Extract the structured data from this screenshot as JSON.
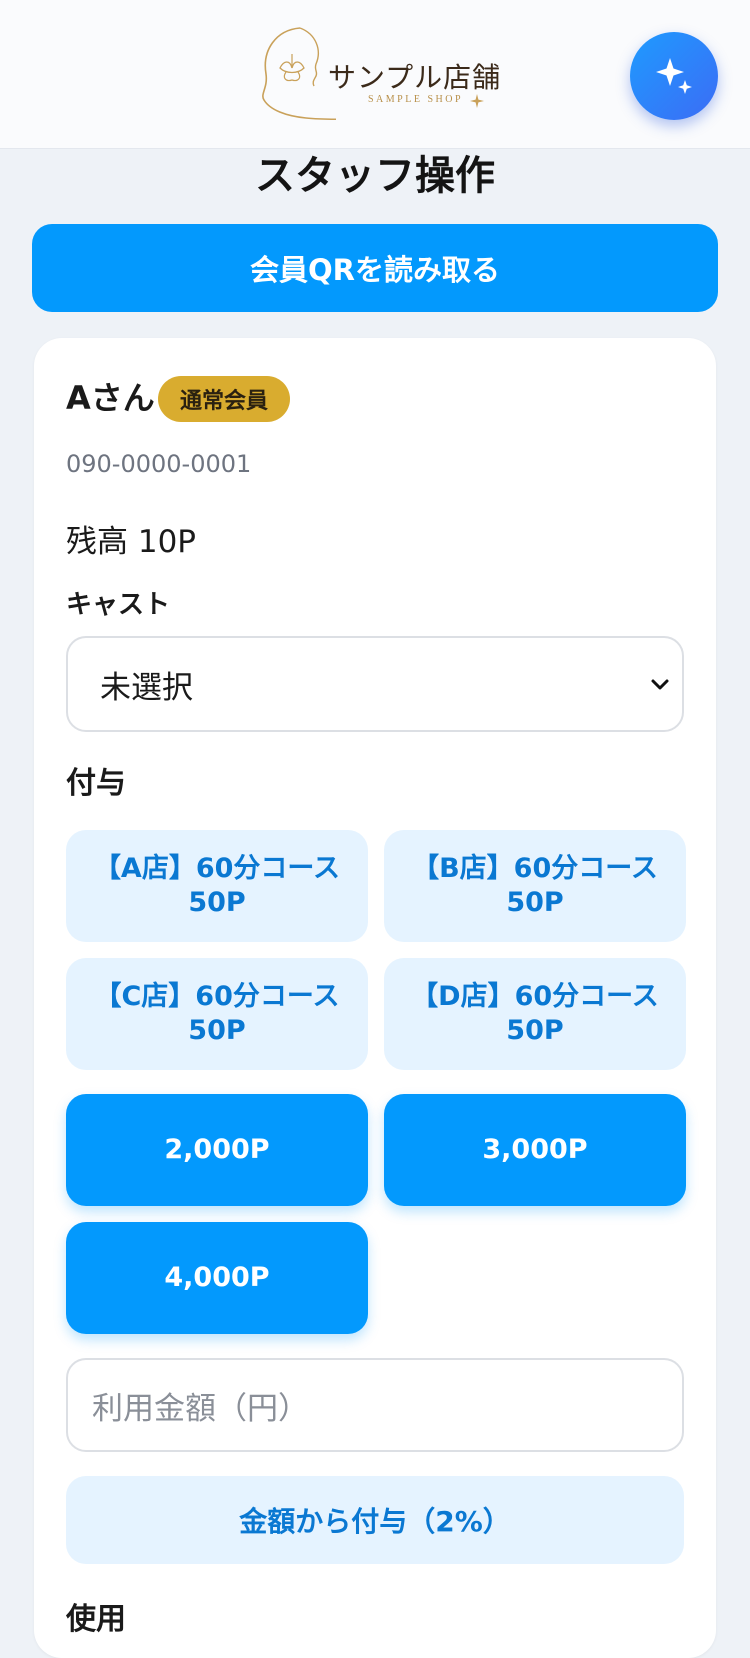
{
  "header": {
    "logo_text": "サンプル店舗",
    "logo_sub": "SAMPLE SHOP",
    "ai_icon": "sparkles-icon"
  },
  "page": {
    "title": "スタッフ操作",
    "scan_button": "会員QRを読み取る"
  },
  "member": {
    "name": "Aさん",
    "badge": "通常会員",
    "phone": "090-0000-0001",
    "balance": "残高 10P"
  },
  "cast": {
    "label": "キャスト",
    "selected": "未選択"
  },
  "grant": {
    "label": "付与",
    "courses": [
      {
        "line1": "【A店】60分コース",
        "line2": "50P"
      },
      {
        "line1": "【B店】60分コース",
        "line2": "50P"
      },
      {
        "line1": "【C店】60分コース",
        "line2": "50P"
      },
      {
        "line1": "【D店】60分コース",
        "line2": "50P"
      }
    ],
    "points": [
      "2,000P",
      "3,000P",
      "4,000P"
    ],
    "amount_placeholder": "利用金額（円）",
    "amount_button": "金額から付与（2%）"
  },
  "use": {
    "label": "使用"
  },
  "colors": {
    "accent": "#0399fd",
    "badge": "#d9ac2f",
    "light_button": "#e5f3ff"
  }
}
